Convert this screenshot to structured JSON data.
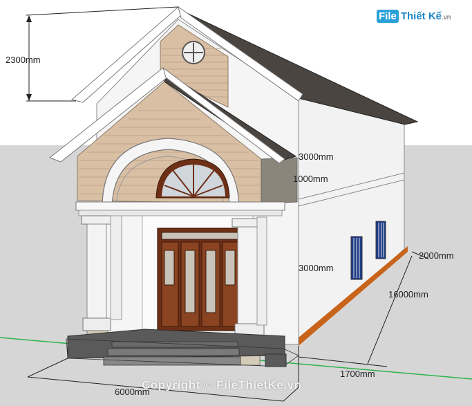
{
  "watermark": {
    "logo_box": "File",
    "logo_text": "Thiết Kế",
    "logo_domain": ".vn",
    "copyright": "Copyright © FileThietKe.vn"
  },
  "dimensions": {
    "gable_height": "2300mm",
    "upper_wall": "3000mm",
    "band": "1000mm",
    "lower_wall": "3000mm",
    "rear_offset": "2000mm",
    "length": "16000mm",
    "porch_depth": "1700mm",
    "width": "6000mm"
  },
  "colors": {
    "sky": "#ffffff",
    "ground": "#d8d8d8",
    "roof": "#4a4540",
    "wood_siding": "#d9bfa4",
    "wall_white": "#f4f4f4",
    "door_wood": "#7a3b1e",
    "axis_green": "#2fb34a"
  }
}
